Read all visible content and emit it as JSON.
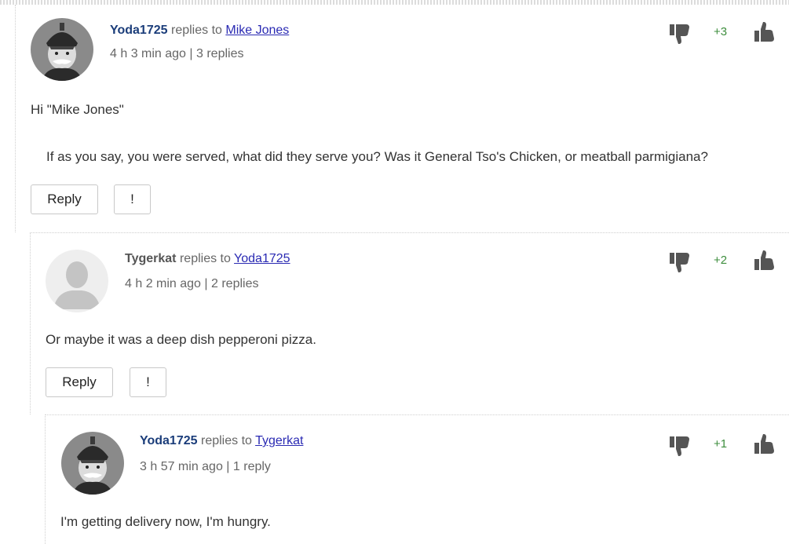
{
  "comments": [
    {
      "author": "Yoda1725",
      "replies_to_text": "replies to",
      "reply_target": "Mike Jones",
      "time": "4 h 3 min ago | 3 replies",
      "body": [
        "Hi \"Mike Jones\"",
        "If as you say, you were served, what did they serve you?  Was it General Tso's Chicken, or meatball parmigiana?"
      ],
      "score": "+3",
      "reply_label": "Reply",
      "flag_label": "!",
      "avatar_icon": "bismarck-portrait-icon"
    },
    {
      "author": "Tygerkat",
      "replies_to_text": "replies to",
      "reply_target": "Yoda1725",
      "time": "4 h 2 min ago | 2 replies",
      "body": [
        "Or maybe it was a deep dish pepperoni pizza."
      ],
      "score": "+2",
      "reply_label": "Reply",
      "flag_label": "!",
      "avatar_icon": "default-user-icon"
    },
    {
      "author": "Yoda1725",
      "replies_to_text": "replies to",
      "reply_target": "Tygerkat",
      "time": "3 h 57 min ago | 1 reply",
      "body": [
        "I'm getting delivery now, I'm hungry."
      ],
      "score": "+1",
      "avatar_icon": "bismarck-portrait-icon"
    }
  ],
  "colors": {
    "author": "#1b3d7a",
    "link": "#2a2ab3",
    "score": "#3e8e3e",
    "thumb": "#555555"
  },
  "icons": {
    "thumb_up": "thumbs-up-icon",
    "thumb_down": "thumbs-down-icon"
  }
}
